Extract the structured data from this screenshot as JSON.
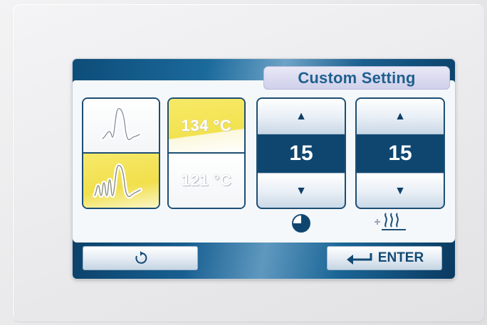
{
  "header": {
    "title": "Custom Setting"
  },
  "program_selector": {
    "options": [
      {
        "icon": "single-pulse-curve-icon",
        "selected": false
      },
      {
        "icon": "multi-pulse-curve-icon",
        "selected": true
      }
    ]
  },
  "temperature_selector": {
    "options": [
      {
        "label": "134 °C",
        "selected": true
      },
      {
        "label": "121 °C",
        "selected": false
      }
    ]
  },
  "sterilization_time": {
    "value": "15",
    "icon": "timer-icon"
  },
  "drying_time": {
    "value": "15",
    "icon": "drying-heat-icon"
  },
  "footer": {
    "enter_label": "ENTER",
    "reset_icon": "reset-arrow-icon"
  },
  "colors": {
    "accent_blue": "#0e4670",
    "selected_yellow": "#f2e353",
    "title_text": "#1f5f8e"
  }
}
